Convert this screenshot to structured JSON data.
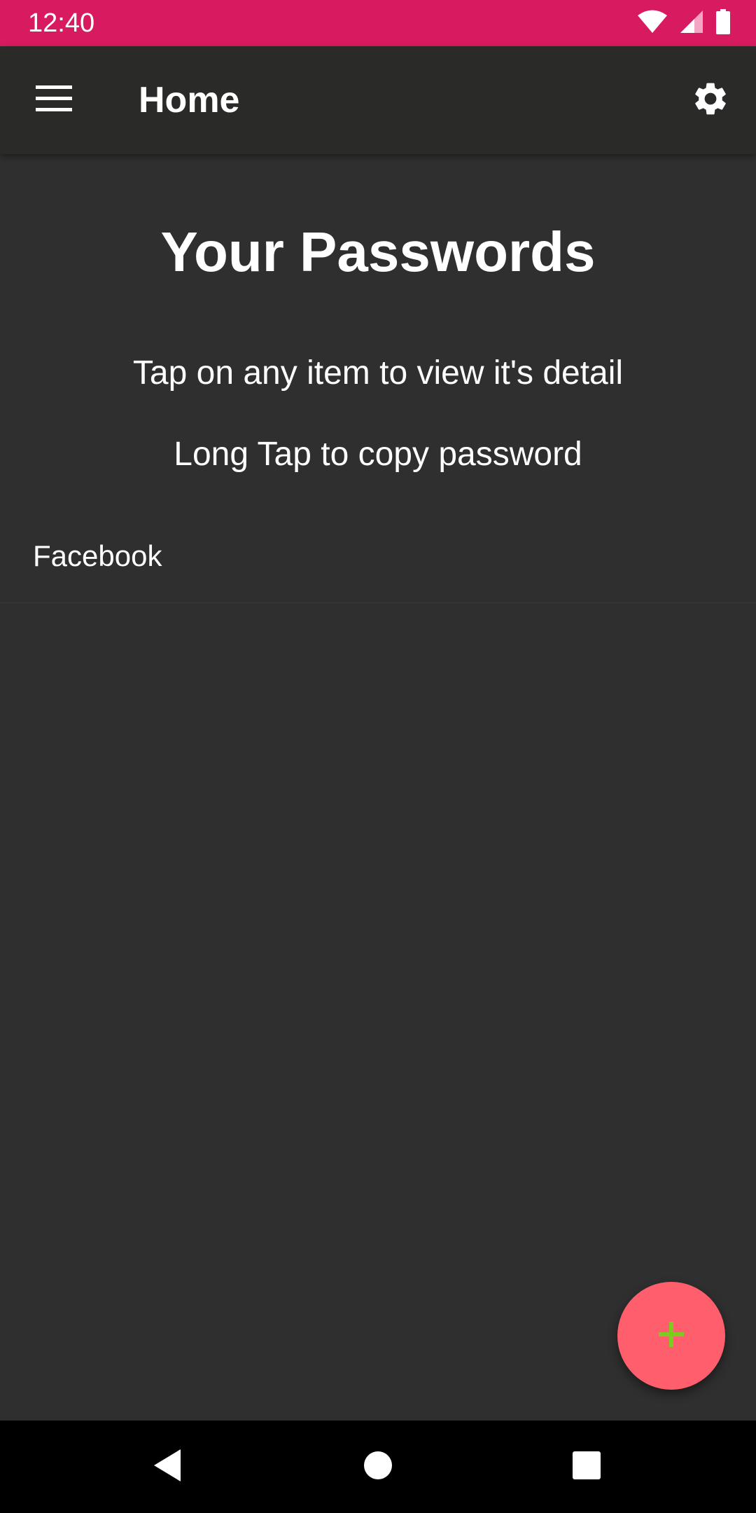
{
  "status_bar": {
    "time": "12:40",
    "color": "#d81b60",
    "icons": [
      "wifi-icon",
      "cell-signal-icon",
      "battery-icon"
    ]
  },
  "app_bar": {
    "title": "Home",
    "menu_icon": "hamburger-menu-icon",
    "settings_icon": "gear-icon",
    "background": "#2a2b28"
  },
  "main": {
    "title": "Your Passwords",
    "hint_view": "Tap on any item to view it's detail",
    "hint_copy": "Long Tap to copy password",
    "items": [
      {
        "label": "Facebook"
      }
    ],
    "background": "#2f2f2f"
  },
  "fab": {
    "icon": "plus-icon",
    "color": "#ff5f6d",
    "icon_color": "#7ecb20"
  },
  "nav_bar": {
    "icons": [
      "back-icon",
      "home-icon",
      "recents-icon"
    ]
  }
}
